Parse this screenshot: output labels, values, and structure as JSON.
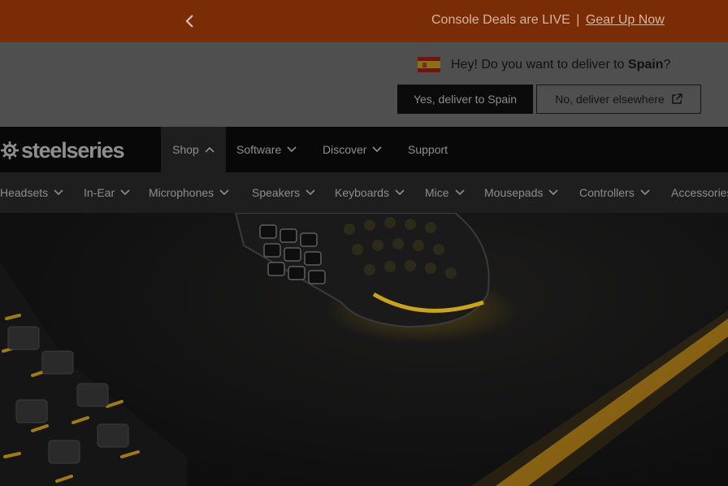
{
  "promo": {
    "message": "Console Deals are LIVE",
    "separator": "|",
    "link": "Gear Up Now"
  },
  "delivery": {
    "question_prefix": "Hey! Do you want to deliver to ",
    "country": "Spain",
    "question_suffix": "?",
    "yes_label": "Yes, deliver to Spain",
    "no_label": "No, deliver elsewhere"
  },
  "brand": {
    "name": "steelseries"
  },
  "nav": {
    "items": [
      {
        "label": "Shop",
        "state": "expanded"
      },
      {
        "label": "Software"
      },
      {
        "label": "Discover"
      },
      {
        "label": "Support"
      }
    ]
  },
  "categories": [
    {
      "label": "Headsets"
    },
    {
      "label": "In-Ear"
    },
    {
      "label": "Microphones"
    },
    {
      "label": "Speakers"
    },
    {
      "label": "Keyboards"
    },
    {
      "label": "Mice"
    },
    {
      "label": "Mousepads"
    },
    {
      "label": "Controllers"
    },
    {
      "label": "Accessories"
    }
  ],
  "colors": {
    "promo_bg": "#7a2c07",
    "overlay_bg": "#4f4f4f",
    "nav_bg": "#080808",
    "accent_glow": "#b98a1a"
  },
  "icons": {
    "promo_prev": "chevron-left-icon",
    "external": "external-link-icon",
    "nav_expand": "chevron-down-icon",
    "nav_collapse": "chevron-up-icon"
  }
}
